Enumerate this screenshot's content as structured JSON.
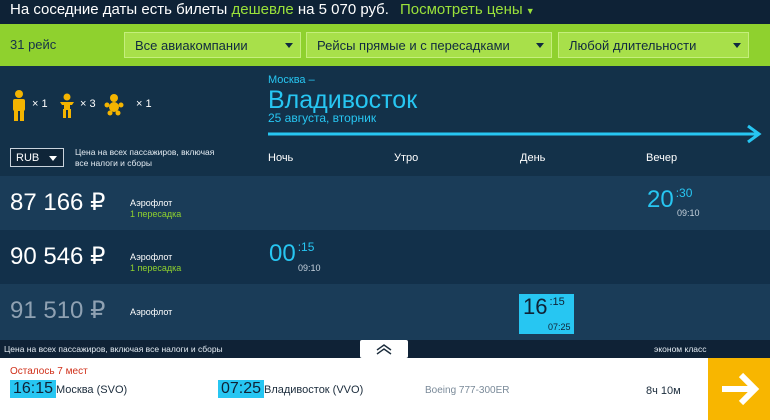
{
  "promo": {
    "text_before": "На соседние даты есть билеты ",
    "text_highlight": "дешевле",
    "text_after": " на 5 070 руб.",
    "link": "Посмотреть цены"
  },
  "filters": {
    "count": "31 рейс",
    "airlines": "Все авиакомпании",
    "transfers": "Рейсы прямые и с пересадками",
    "duration": "Любой длительности"
  },
  "passengers": {
    "adults": "× 1",
    "children": "× 3",
    "infants": "× 1"
  },
  "route": {
    "from": "Москва –",
    "to": "Владивосток",
    "date": "25 августа, вторник"
  },
  "currency": "RUB",
  "price_note": "Цена на всех пассажиров, включая все налоги и сборы",
  "times_of_day": [
    "Ночь",
    "Утро",
    "День",
    "Вечер"
  ],
  "flights": [
    {
      "price": "87 166 ₽",
      "airline": "Аэрофлот",
      "stops": "1 пересадка",
      "dep_hour": "20",
      "dep_min": ":30",
      "duration": "09:10"
    },
    {
      "price": "90 546 ₽",
      "airline": "Аэрофлот",
      "stops": "1 пересадка",
      "dep_hour": "00",
      "dep_min": ":15",
      "duration": "09:10"
    },
    {
      "price": "91 510 ₽",
      "airline": "Аэрофлот",
      "stops": "",
      "dep_hour": "16",
      "dep_min": ":15",
      "duration": "07:25"
    }
  ],
  "details": {
    "note": "Цена на всех пассажиров, включая все налоги и сборы",
    "class": "эконом класс",
    "seats": "Осталось 7 мест",
    "dep_time": "16:15",
    "dep_city": "Москва (SVO)",
    "arr_time": "07:25",
    "arr_city": "Владивосток (VVO)",
    "aircraft": "Boeing 777-300ER",
    "duration": "8ч 10м"
  },
  "colors": {
    "accent": "#27c6f2",
    "green": "#8fd12e",
    "person_icon": "#f4b400",
    "go_button": "#f8b600"
  },
  "icons": [
    "adult-icon",
    "child-icon",
    "infant-icon",
    "route-arrow-icon",
    "chevron-up-icon",
    "arrow-right-icon"
  ]
}
